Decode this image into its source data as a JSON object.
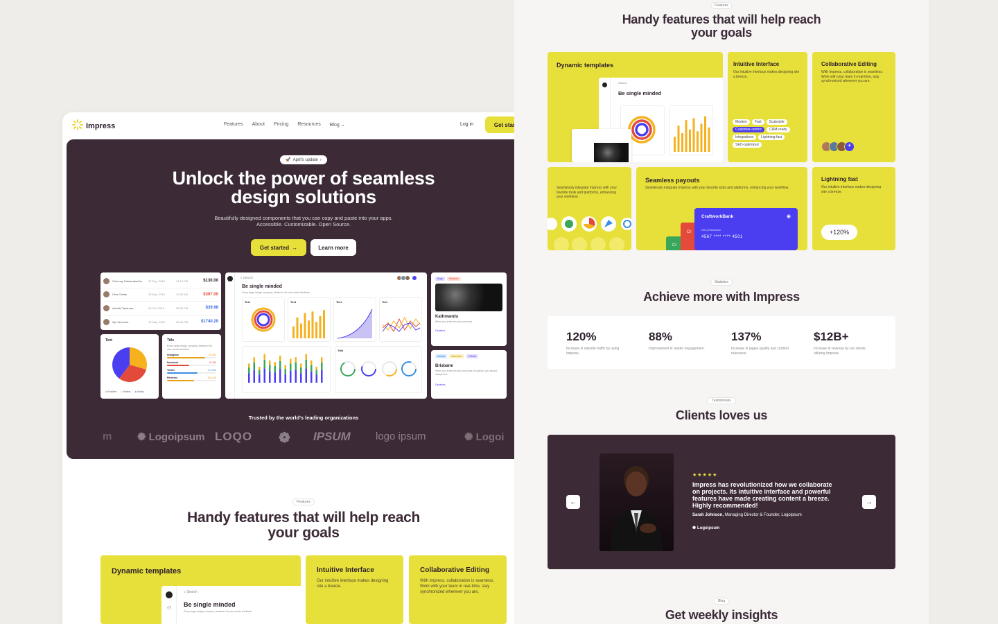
{
  "left": {
    "brand": "Impress",
    "nav": [
      "Features",
      "About",
      "Pricing",
      "Resources",
      "Blog"
    ],
    "login": "Log in",
    "cta": "Get started",
    "hero": {
      "badge": "April's update",
      "title_line1": "Unlock the power of seamless",
      "title_line2": "design solutions",
      "subtitle_line1": "Beautifully designed components that you can copy and paste into your apps.",
      "subtitle_line2": "Accessible. Customizable. Open Source.",
      "btn_primary": "Get started",
      "btn_secondary": "Learn more"
    },
    "transactions": [
      {
        "name": "Chinmay Sahasrabudhe",
        "date": "23 Sep, 2018",
        "time": "12:12 PM",
        "amount": "$130.00",
        "color": "#2a1f2a"
      },
      {
        "name": "Gina Clarke",
        "date": "23 Sep, 2018",
        "time": "10:00 AM",
        "amount": "$367.00",
        "color": "#e34a3a"
      },
      {
        "name": "Ashiriki Takahara",
        "date": "09 Oct, 2018",
        "time": "08:00 PM",
        "amount": "$39.98",
        "color": "#3a6ee3"
      },
      {
        "name": "Ojo Verchera",
        "date": "16 May, 2019",
        "time": "02:44 PM",
        "amount": "$1740.29",
        "color": "#3a6ee3"
      }
    ],
    "pie_card_title": "Text",
    "pie_legend": [
      "Realities",
      "Hiatfos",
      "Avidity"
    ],
    "title_card": {
      "title": "Title",
      "desc": "Every large design company, whatever it's size needs feedback",
      "rows": [
        {
          "label": "Instagram",
          "value": "50,259",
          "color": "#e8a21a",
          "pct": 0.78
        },
        {
          "label": "Facebook",
          "value": "15,185",
          "color": "#e34a3a",
          "pct": 0.45
        },
        {
          "label": "Twitter",
          "value": "171,544",
          "color": "#3a8ee3",
          "pct": 0.62
        },
        {
          "label": "Pinterest",
          "value": "100,418",
          "color": "#e8a21a",
          "pct": 0.55
        }
      ]
    },
    "dash": {
      "search": "Search",
      "title": "Be single minded",
      "desc": "Every large design company, whatever it's size needs feedback",
      "chart_labels": [
        "Text",
        "Text",
        "Text",
        "Text"
      ],
      "title2": "Title"
    },
    "city1": {
      "tags": [
        "Bugs",
        "Reliance"
      ],
      "name": "Kathmandu",
      "desc": "When you enter into any new area",
      "link": "Detailes"
    },
    "city2": {
      "tags": [
        "Islands",
        "Adventure",
        "Rubble"
      ],
      "name": "Brisbane",
      "desc": "When you enter into any new area of science, you almost always find.",
      "link": "Detailes"
    },
    "trusted": "Trusted by the world's leading organizations",
    "logos": [
      "Logoipsum",
      "LOQO",
      "IPSUM",
      "logo ipsum",
      "Logoi"
    ],
    "features_pill": "Features",
    "features_title_line1": "Handy features that will help reach",
    "features_title_line2": "your goals",
    "features": [
      {
        "title": "Dynamic templates"
      },
      {
        "title": "Intuitive Interface",
        "desc": "Our intuitive interface makes designing site a breeze."
      },
      {
        "title": "Collaborative Editing",
        "desc": "With Impress, collaboration is seamless. Work with your team in real-time, stay synchronized wherever you are."
      }
    ],
    "dyn_mock": {
      "search": "Search",
      "title": "Be single minded",
      "desc": "Every large design company, whatever it's size needs feedback"
    }
  },
  "right": {
    "features_pill": "Features",
    "features_title_line1": "Handy features that will help reach",
    "features_title_line2": "your goals",
    "cards": {
      "dynamic": {
        "title": "Dynamic templates",
        "mock_title": "Be single minded",
        "mock_search": "Search"
      },
      "intuitive": {
        "title": "Intuitive Interface",
        "desc": "Our intuitive interface makes designing site a breeze.",
        "tags": [
          "Modern",
          "Fast",
          "Scaleable",
          "Customer-centric",
          "CRM-ready",
          "Integrations",
          "Lightning-fast",
          "SEO-optimized"
        ]
      },
      "collab": {
        "title": "Collaborative Editing",
        "desc": "With Impress, collaboration is seamless. Work with your team in real-time, stay synchronized wherever you are."
      },
      "integrate": {
        "desc": "Seamlessly integrate Impress with your favorite tools and platforms, enhancing your workflow."
      },
      "payouts": {
        "title": "Seamless payouts",
        "desc": "Seamlessly integrate Impress with your favorite tools and platforms, enhancing your workflow.",
        "bank": "CraftworkBank",
        "holder": "Henry Richardson",
        "number": "4567 **** **** 4501",
        "back_label": "Cr"
      },
      "lightning": {
        "title": "Lightning fast",
        "desc": "Our intuitive interface makes designing site a breeze.",
        "badge": "+120%"
      }
    },
    "stats_pill": "Statistics",
    "stats_title": "Achieve more with Impress",
    "stats": [
      {
        "value": "120%",
        "desc": "Increase in website traffic by using Impress."
      },
      {
        "value": "88%",
        "desc": "Improvement in reader engagement."
      },
      {
        "value": "137%",
        "desc": "Increase in pages quality and content relevance"
      },
      {
        "value": "$12B+",
        "desc": "Increase in revenue by our clients utilizing Impress"
      }
    ],
    "testimonials_pill": "Testimonials",
    "testimonials_title": "Clients loves us",
    "testimonial": {
      "stars": "★★★★★",
      "quote": "Impress has revolutionized how we collaborate on projects. Its intuitive interface and powerful features have made creating content a breeze. Highly recommended!",
      "author": "Sarah Johnson,",
      "role": " Managing Director & Founder, Logoipsum",
      "company": "Logoipsum"
    },
    "blog_pill": "Blog",
    "blog_title": "Get weekly insights"
  },
  "colors": {
    "accent": "#e8e03a",
    "dark": "#3d2a37",
    "blue": "#4a3ef0",
    "red": "#e34a3a"
  }
}
